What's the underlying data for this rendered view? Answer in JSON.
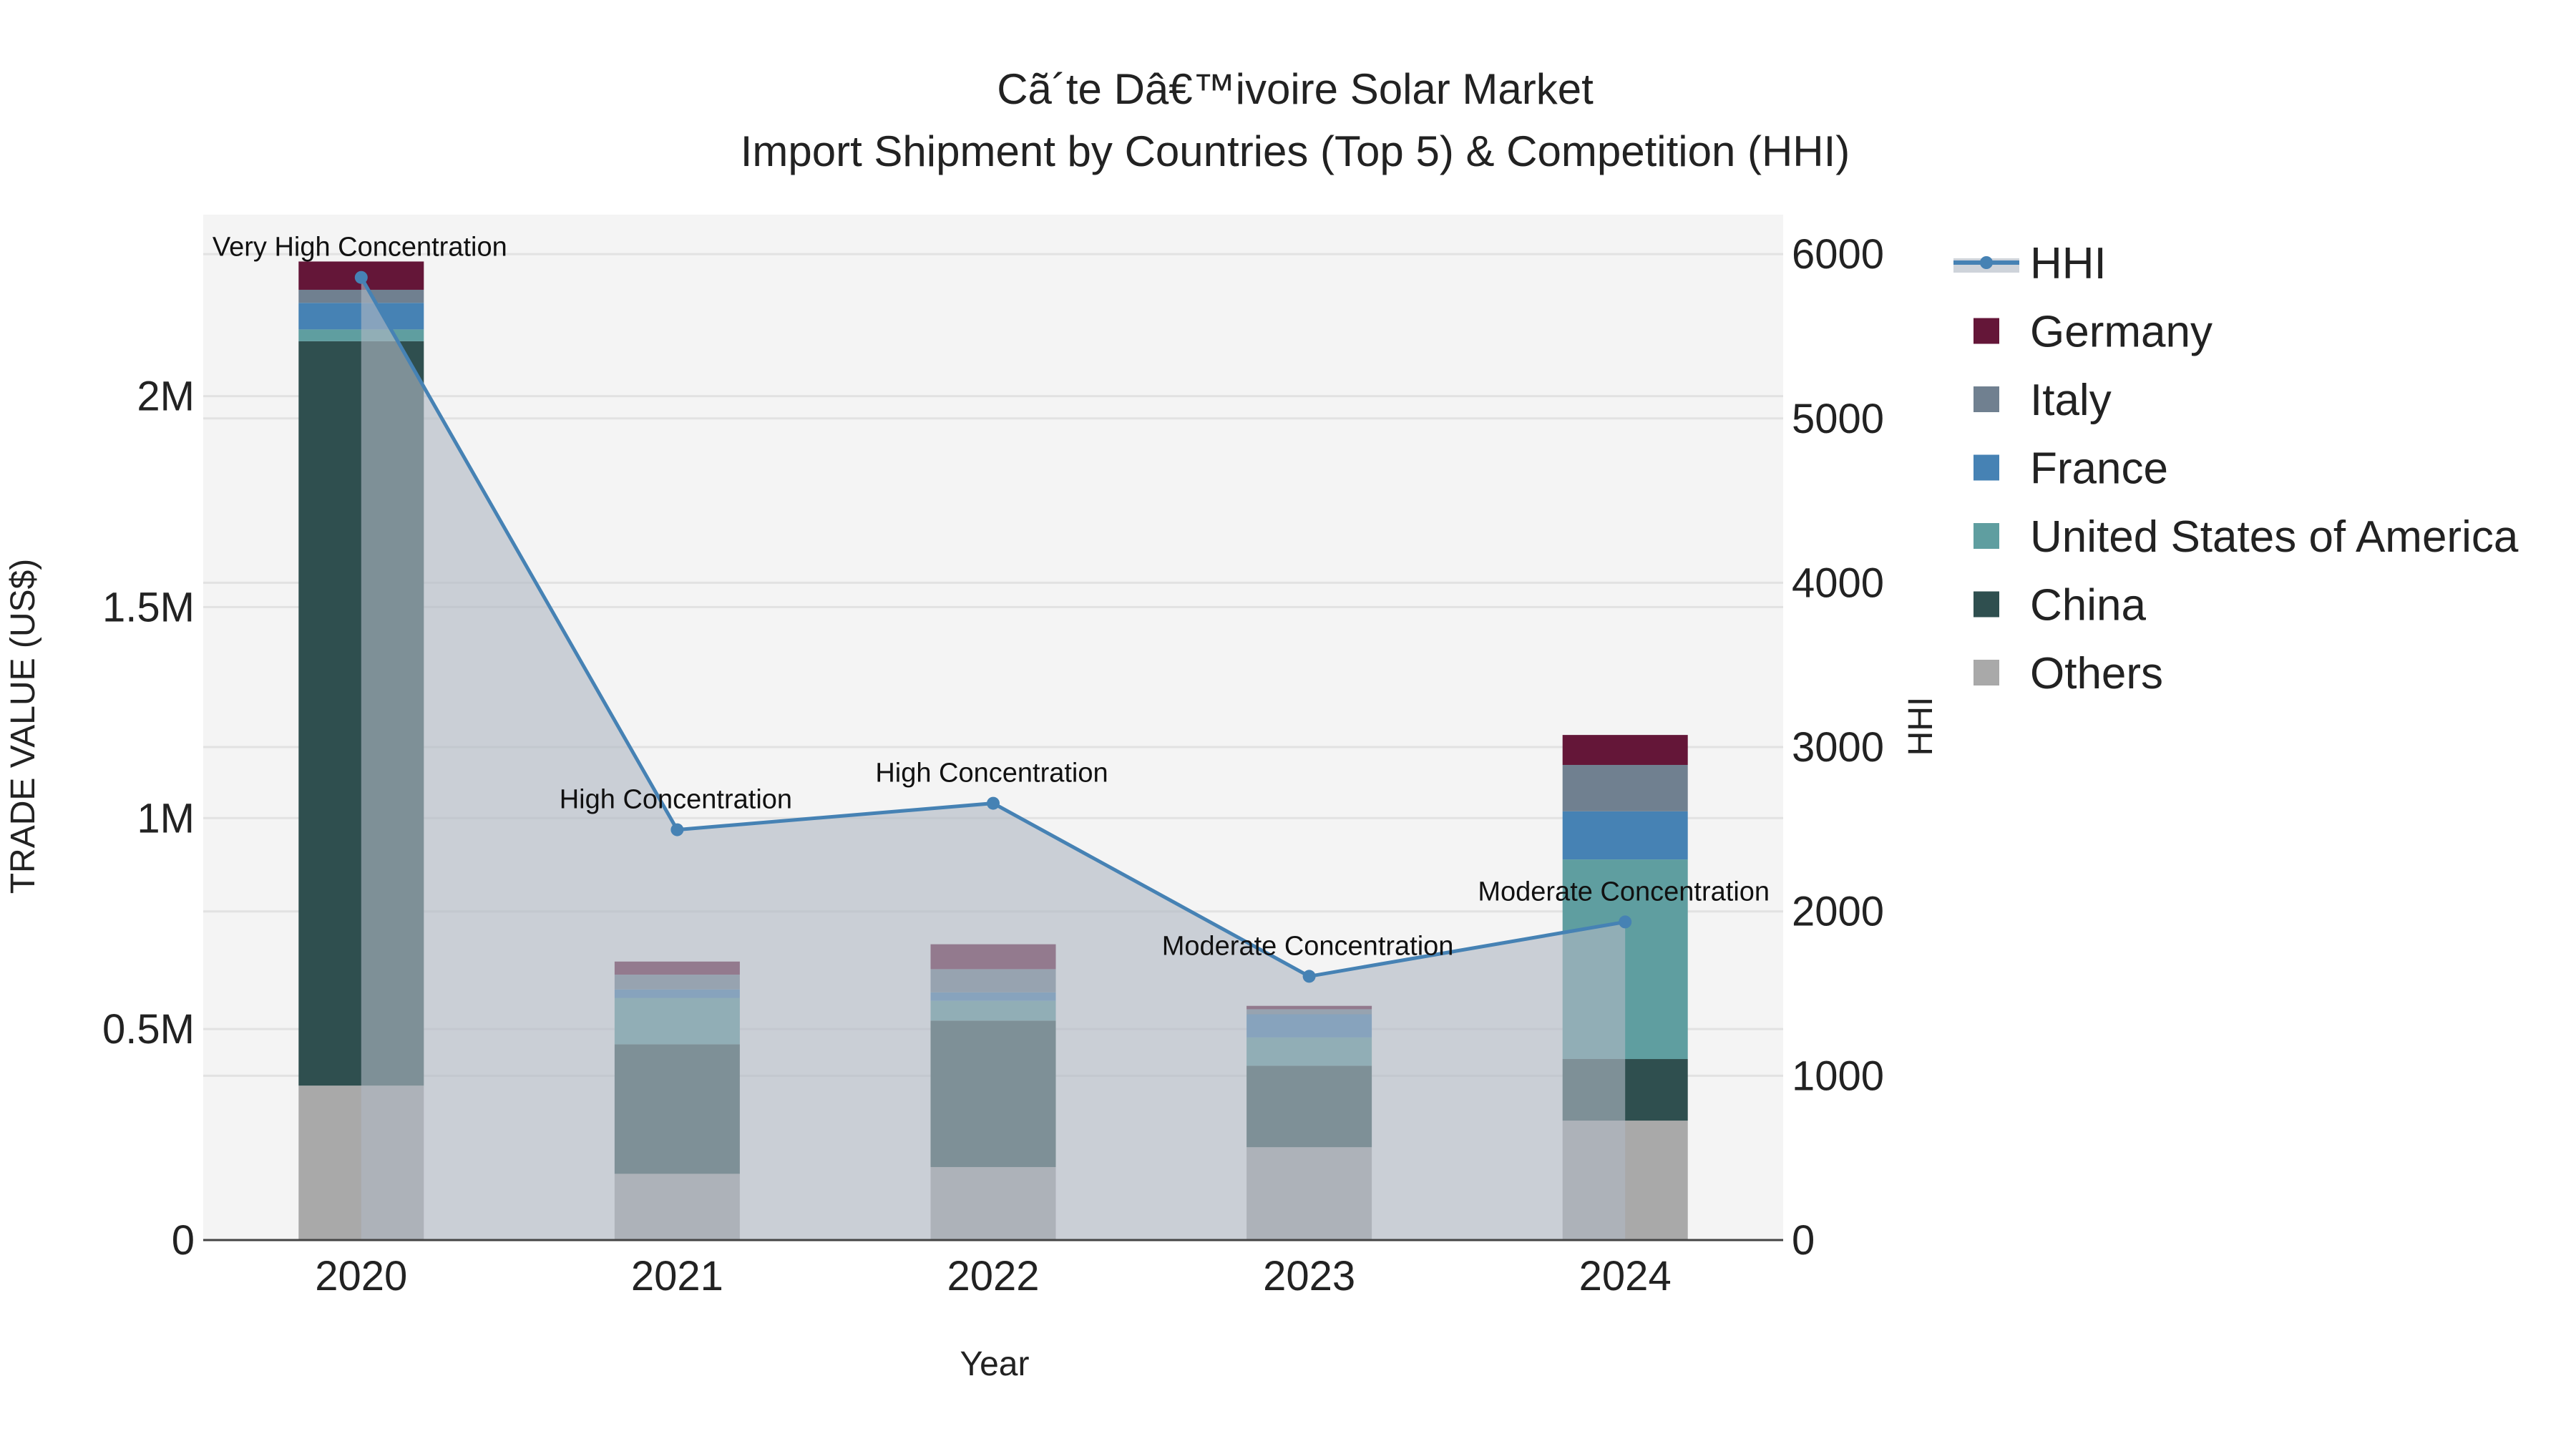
{
  "chart_data": {
    "type": "bar",
    "title": "Cã´te Dâ€™ivoire Solar Market",
    "subtitle": "Import Shipment by Countries (Top 5) & Competition (HHI)",
    "xlabel": "Year",
    "ylabel": "TRADE VALUE (US$)",
    "y2label": "HHI",
    "categories": [
      "2020",
      "2021",
      "2022",
      "2023",
      "2024"
    ],
    "ylim": [
      0,
      2430000
    ],
    "y2lim": [
      0,
      6240
    ],
    "yticks": [
      {
        "v": 0,
        "label": "0"
      },
      {
        "v": 500000,
        "label": "0.5M"
      },
      {
        "v": 1000000,
        "label": "1M"
      },
      {
        "v": 1500000,
        "label": "1.5M"
      },
      {
        "v": 2000000,
        "label": "2M"
      }
    ],
    "y2ticks": [
      {
        "v": 0,
        "label": "0"
      },
      {
        "v": 1000,
        "label": "1000"
      },
      {
        "v": 2000,
        "label": "2000"
      },
      {
        "v": 3000,
        "label": "3000"
      },
      {
        "v": 4000,
        "label": "4000"
      },
      {
        "v": 5000,
        "label": "5000"
      },
      {
        "v": 6000,
        "label": "6000"
      }
    ],
    "series": [
      {
        "name": "Others",
        "color": "#A9A9A9",
        "values": [
          366000,
          157000,
          173000,
          220000,
          283000
        ]
      },
      {
        "name": "China",
        "color": "#2F4F4F",
        "values": [
          1764000,
          307000,
          347000,
          193000,
          146000
        ]
      },
      {
        "name": "United States of America",
        "color": "#5F9EA0",
        "values": [
          28000,
          110000,
          47000,
          67000,
          473000
        ]
      },
      {
        "name": "France",
        "color": "#4682B4",
        "values": [
          63000,
          20000,
          20000,
          55000,
          114000
        ]
      },
      {
        "name": "Italy",
        "color": "#708090",
        "values": [
          31000,
          35000,
          55000,
          12000,
          110000
        ]
      },
      {
        "name": "Germany",
        "color": "#641638",
        "values": [
          67000,
          31000,
          59000,
          8000,
          71000
        ]
      }
    ],
    "hhi": {
      "name": "HHI",
      "color": "#4682B4",
      "values": [
        5858,
        2497,
        2658,
        1605,
        1936
      ],
      "annotations": [
        "Very High Concentration",
        "High Concentration",
        "High Concentration",
        "Moderate Concentration",
        "Moderate Concentration"
      ]
    },
    "legend": [
      "HHI",
      "Germany",
      "Italy",
      "France",
      "United States of America",
      "China",
      "Others"
    ],
    "legend_placement": "right",
    "grid": true
  }
}
